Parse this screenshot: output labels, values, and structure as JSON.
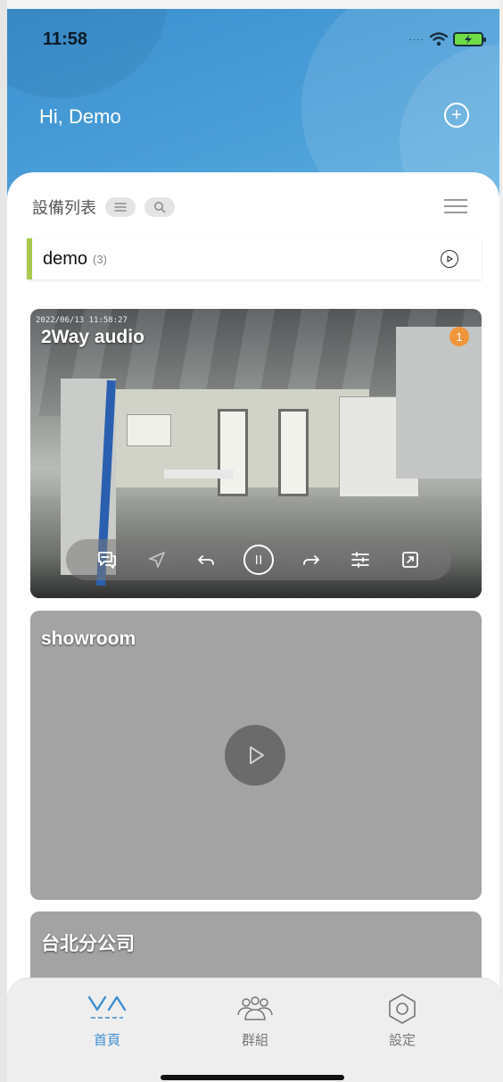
{
  "status_bar": {
    "time": "11:58"
  },
  "header": {
    "greeting": "Hi, Demo",
    "add_icon": "plus-circle-icon"
  },
  "device_list": {
    "title": "設備列表",
    "group": {
      "name": "demo",
      "count": "(3)"
    }
  },
  "cameras": [
    {
      "name": "2Way audio",
      "timestamp": "2022/06/13 11:58:27",
      "badge": "1",
      "live": true
    },
    {
      "name": "showroom",
      "live": false
    },
    {
      "name": "台北分公司",
      "live": false
    }
  ],
  "controls": [
    "chat-icon",
    "location-icon",
    "undo-icon",
    "pause-icon",
    "redo-icon",
    "sliders-icon",
    "fullscreen-icon"
  ],
  "tabs": [
    {
      "label": "首頁",
      "icon": "vacron-logo-icon",
      "active": true
    },
    {
      "label": "群組",
      "icon": "group-icon",
      "active": false
    },
    {
      "label": "設定",
      "icon": "settings-icon",
      "active": false
    }
  ],
  "colors": {
    "accent": "#3d8ed0",
    "group_bar": "#a7c94e",
    "badge": "#f0953a"
  }
}
